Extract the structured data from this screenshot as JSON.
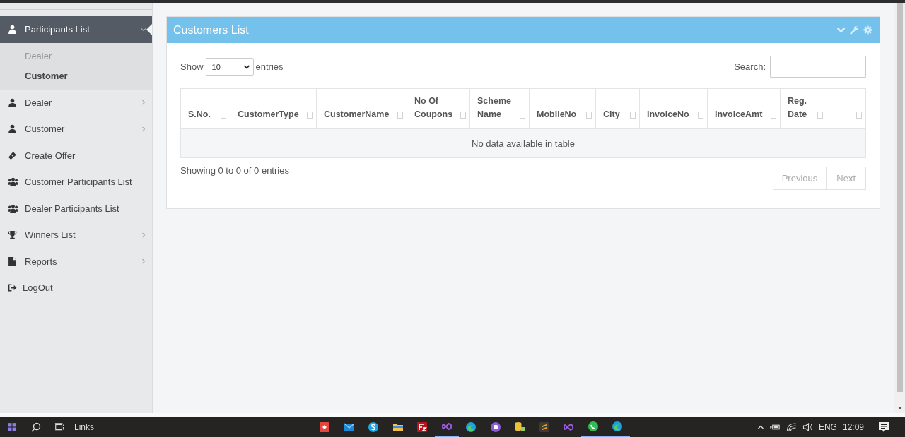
{
  "sidebar": {
    "items": [
      {
        "label": "Participants List",
        "kind": "person",
        "expandable": true,
        "expanded": true,
        "children": [
          {
            "label": "Dealer",
            "selected": false
          },
          {
            "label": "Customer",
            "selected": true
          }
        ]
      },
      {
        "label": "Dealer",
        "kind": "person",
        "expandable": true,
        "expanded": false
      },
      {
        "label": "Customer",
        "kind": "person",
        "expandable": true,
        "expanded": false
      },
      {
        "label": "Create Offer",
        "kind": "ticket",
        "expandable": false,
        "expanded": false
      },
      {
        "label": "Customer Participants List",
        "kind": "group",
        "expandable": false,
        "expanded": false
      },
      {
        "label": "Dealer Participants List",
        "kind": "group",
        "expandable": false,
        "expanded": false
      },
      {
        "label": "Winners List",
        "kind": "trophy",
        "expandable": true,
        "expanded": false
      },
      {
        "label": "Reports",
        "kind": "file",
        "expandable": true,
        "expanded": false
      },
      {
        "label": "LogOut",
        "kind": "signout",
        "expandable": false,
        "expanded": false
      }
    ]
  },
  "panel": {
    "title": "Customers List",
    "length_menu": {
      "label_before": "Show",
      "value": "10",
      "label_after": "entries"
    },
    "search": {
      "label": "Search:"
    },
    "table": {
      "columns": [
        {
          "label": "S.No.",
          "sortable": true
        },
        {
          "label": "CustomerType",
          "sortable": true
        },
        {
          "label": "CustomerName",
          "sortable": true
        },
        {
          "label": "No Of Coupons",
          "sortable": true
        },
        {
          "label": "Scheme Name",
          "sortable": true
        },
        {
          "label": "MobileNo",
          "sortable": true
        },
        {
          "label": "City",
          "sortable": true
        },
        {
          "label": "InvoiceNo",
          "sortable": true
        },
        {
          "label": "InvoiceAmt",
          "sortable": true
        },
        {
          "label": "Reg. Date",
          "sortable": true
        },
        {
          "sortable": true
        }
      ],
      "empty_message": "No data available in table"
    },
    "info": "Showing 0 to 0 of 0 entries",
    "pagination": [
      {
        "label": "Previous",
        "disabled": true
      },
      {
        "label": "Next",
        "disabled": true
      }
    ]
  },
  "taskbar": {
    "search_label": "Links",
    "apps": [
      {
        "kind": "red",
        "selected": false
      },
      {
        "kind": "mail",
        "selected": false
      },
      {
        "kind": "skype",
        "selected": false
      },
      {
        "kind": "folder",
        "selected": false
      },
      {
        "kind": "filezilla",
        "selected": false
      },
      {
        "kind": "vs",
        "selected": true
      },
      {
        "kind": "edge",
        "selected": false
      },
      {
        "kind": "purple",
        "selected": false
      },
      {
        "kind": "db",
        "selected": false
      },
      {
        "kind": "sublime",
        "selected": false
      },
      {
        "kind": "vs",
        "selected": false
      },
      {
        "kind": "whatsapp",
        "selected": true
      },
      {
        "kind": "edge",
        "selected": true
      }
    ],
    "language": "ENG",
    "time": "12:09"
  }
}
